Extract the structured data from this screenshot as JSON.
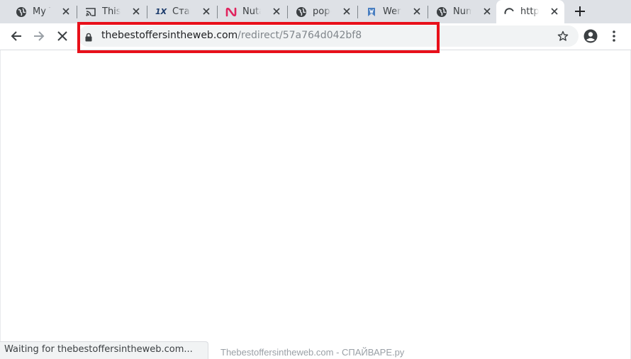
{
  "tabs": [
    {
      "label": "My Top",
      "icon": "globe-icon"
    },
    {
      "label": "This c",
      "icon": "cast-icon"
    },
    {
      "label": "Ставк",
      "icon": "1x-logo-icon"
    },
    {
      "label": "Nutal",
      "icon": "nutaku-logo-icon"
    },
    {
      "label": "popca",
      "icon": "globe-icon"
    },
    {
      "label": "Wem",
      "icon": "bookmark-logo-icon"
    },
    {
      "label": "Numl",
      "icon": "globe-icon"
    },
    {
      "label": "https",
      "icon": "loading-spinner-icon",
      "active": true
    }
  ],
  "tab_icon_text": {
    "onex": "1X"
  },
  "toolbar": {
    "url_host": "thebestoffersintheweb.com",
    "url_path": "/redirect/57a764d042bf8"
  },
  "status_bar": {
    "text": "Waiting for thebestoffersintheweb.com..."
  },
  "watermark": {
    "text": "Thebestoffersintheweb.com - СПАЙВАРЕ.ру"
  },
  "colors": {
    "highlight": "#e8101a",
    "tabstrip": "#dee1e6",
    "omnibox": "#f1f3f4"
  }
}
